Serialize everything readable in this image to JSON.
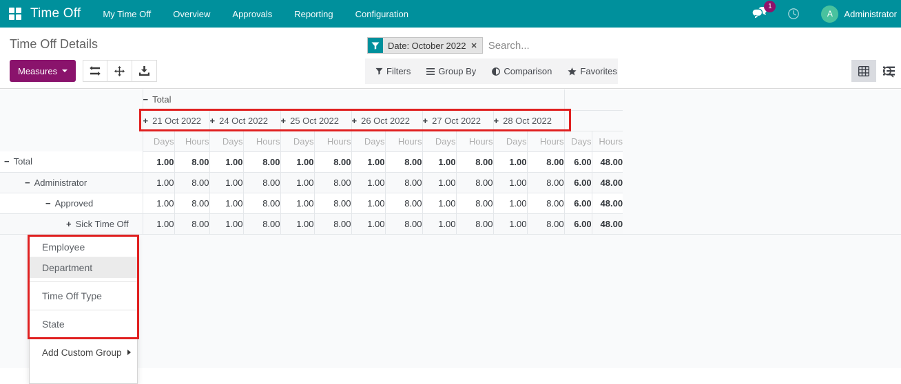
{
  "navbar": {
    "app_title": "Time Off",
    "menu_items": [
      {
        "label": "My Time Off"
      },
      {
        "label": "Overview"
      },
      {
        "label": "Approvals"
      },
      {
        "label": "Reporting"
      },
      {
        "label": "Configuration"
      }
    ],
    "message_badge_count": "1",
    "user_initial": "A",
    "user_name": "Administrator"
  },
  "control_panel": {
    "title": "Time Off Details",
    "measures_label": "Measures",
    "search_facet": "Date: October 2022",
    "search_placeholder": "Search...",
    "filter_buttons": [
      {
        "label": "Filters",
        "icon": "funnel-icon"
      },
      {
        "label": "Group By",
        "icon": "bars-icon"
      },
      {
        "label": "Comparison",
        "icon": "half-circle-icon"
      },
      {
        "label": "Favorites",
        "icon": "star-icon"
      }
    ]
  },
  "pivot": {
    "col_root_label": "Total",
    "date_columns": [
      "21 Oct 2022",
      "24 Oct 2022",
      "25 Oct 2022",
      "26 Oct 2022",
      "27 Oct 2022",
      "28 Oct 2022"
    ],
    "measures": [
      "Days",
      "Hours"
    ],
    "rows": [
      {
        "label": "Total",
        "indent": 0,
        "expander": "minus",
        "bold": true,
        "values": [
          "1.00",
          "8.00",
          "1.00",
          "8.00",
          "1.00",
          "8.00",
          "1.00",
          "8.00",
          "1.00",
          "8.00",
          "1.00",
          "8.00",
          "6.00",
          "48.00"
        ]
      },
      {
        "label": "Administrator",
        "indent": 1,
        "expander": "minus",
        "bold": false,
        "values": [
          "1.00",
          "8.00",
          "1.00",
          "8.00",
          "1.00",
          "8.00",
          "1.00",
          "8.00",
          "1.00",
          "8.00",
          "1.00",
          "8.00",
          "6.00",
          "48.00"
        ]
      },
      {
        "label": "Approved",
        "indent": 2,
        "expander": "minus",
        "bold": false,
        "values": [
          "1.00",
          "8.00",
          "1.00",
          "8.00",
          "1.00",
          "8.00",
          "1.00",
          "8.00",
          "1.00",
          "8.00",
          "1.00",
          "8.00",
          "6.00",
          "48.00"
        ]
      },
      {
        "label": "Sick Time Off",
        "indent": 3,
        "expander": "plus",
        "bold": false,
        "values": [
          "1.00",
          "8.00",
          "1.00",
          "8.00",
          "1.00",
          "8.00",
          "1.00",
          "8.00",
          "1.00",
          "8.00",
          "1.00",
          "8.00",
          "6.00",
          "48.00"
        ]
      }
    ]
  },
  "groupby_menu": {
    "items": [
      {
        "label": "Employee",
        "highlighted": false
      },
      {
        "label": "Department",
        "highlighted": true
      },
      {
        "label": "Time Off Type",
        "highlighted": false
      },
      {
        "label": "State",
        "highlighted": false
      }
    ],
    "footer": "Add Custom Group"
  }
}
